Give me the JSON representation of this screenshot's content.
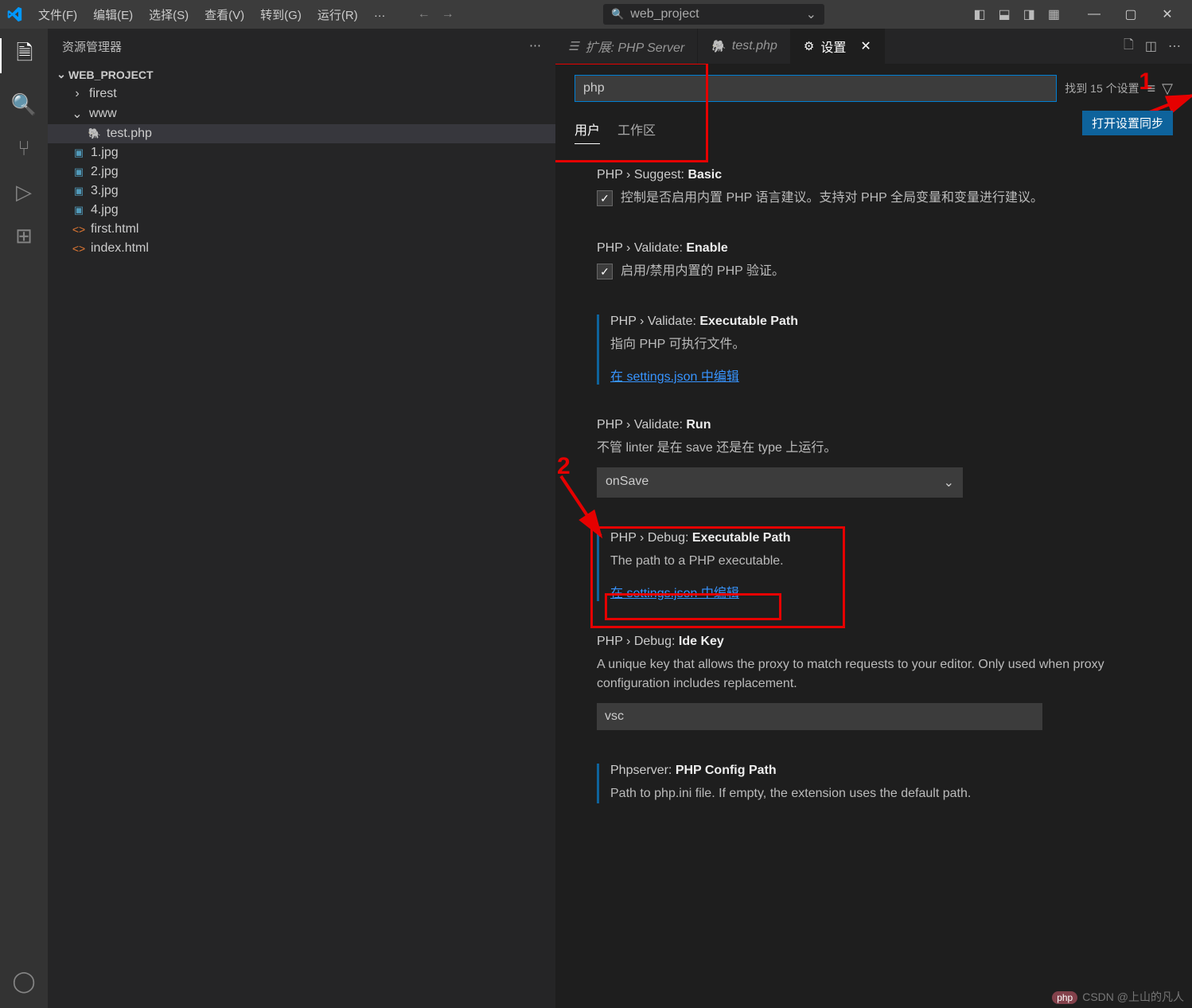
{
  "menu": [
    "文件(F)",
    "编辑(E)",
    "选择(S)",
    "查看(V)",
    "转到(G)",
    "运行(R)",
    "…"
  ],
  "searchCenter": "web_project",
  "sidebar": {
    "title": "资源管理器",
    "folder": "WEB_PROJECT"
  },
  "tree": {
    "firest": "firest",
    "www": "www",
    "test": "test.php",
    "img1": "1.jpg",
    "img2": "2.jpg",
    "img3": "3.jpg",
    "img4": "4.jpg",
    "first": "first.html",
    "index": "index.html"
  },
  "tabs": {
    "ext": "扩展: PHP Server",
    "test": "test.php",
    "settings": "设置"
  },
  "search": {
    "value": "php",
    "found": "找到 15 个设置"
  },
  "scopes": {
    "user": "用户",
    "workspace": "工作区"
  },
  "syncBtn": "打开设置同步",
  "settings": [
    {
      "cat": "PHP › Suggest: ",
      "name": "Basic",
      "desc": "控制是否启用内置 PHP 语言建议。支持对 PHP 全局变量和变量进行建议。",
      "type": "check"
    },
    {
      "cat": "PHP › Validate: ",
      "name": "Enable",
      "desc": "启用/禁用内置的 PHP 验证。",
      "type": "check"
    },
    {
      "cat": "PHP › Validate: ",
      "name": "Executable Path",
      "desc": "指向 PHP 可执行文件。",
      "type": "link",
      "link": "在 settings.json 中编辑"
    },
    {
      "cat": "PHP › Validate: ",
      "name": "Run",
      "desc": "不管 linter 是在 save 还是在 type 上运行。",
      "type": "select",
      "value": "onSave"
    },
    {
      "cat": "PHP › Debug: ",
      "name": "Executable Path",
      "desc": "The path to a PHP executable.",
      "type": "link",
      "link": "在 settings.json 中编辑"
    },
    {
      "cat": "PHP › Debug: ",
      "name": "Ide Key",
      "desc": "A unique key that allows the proxy to match requests to your editor. Only used when proxy configuration includes replacement.",
      "type": "text",
      "value": "vsc"
    },
    {
      "cat": "Phpserver: ",
      "name": "PHP Config Path",
      "desc": "Path to php.ini file. If empty, the extension uses the default path.",
      "type": "none"
    }
  ],
  "annotations": {
    "one": "1",
    "two": "2"
  },
  "watermark": {
    "pill": "php",
    "text": "CSDN @上山的凡人"
  }
}
